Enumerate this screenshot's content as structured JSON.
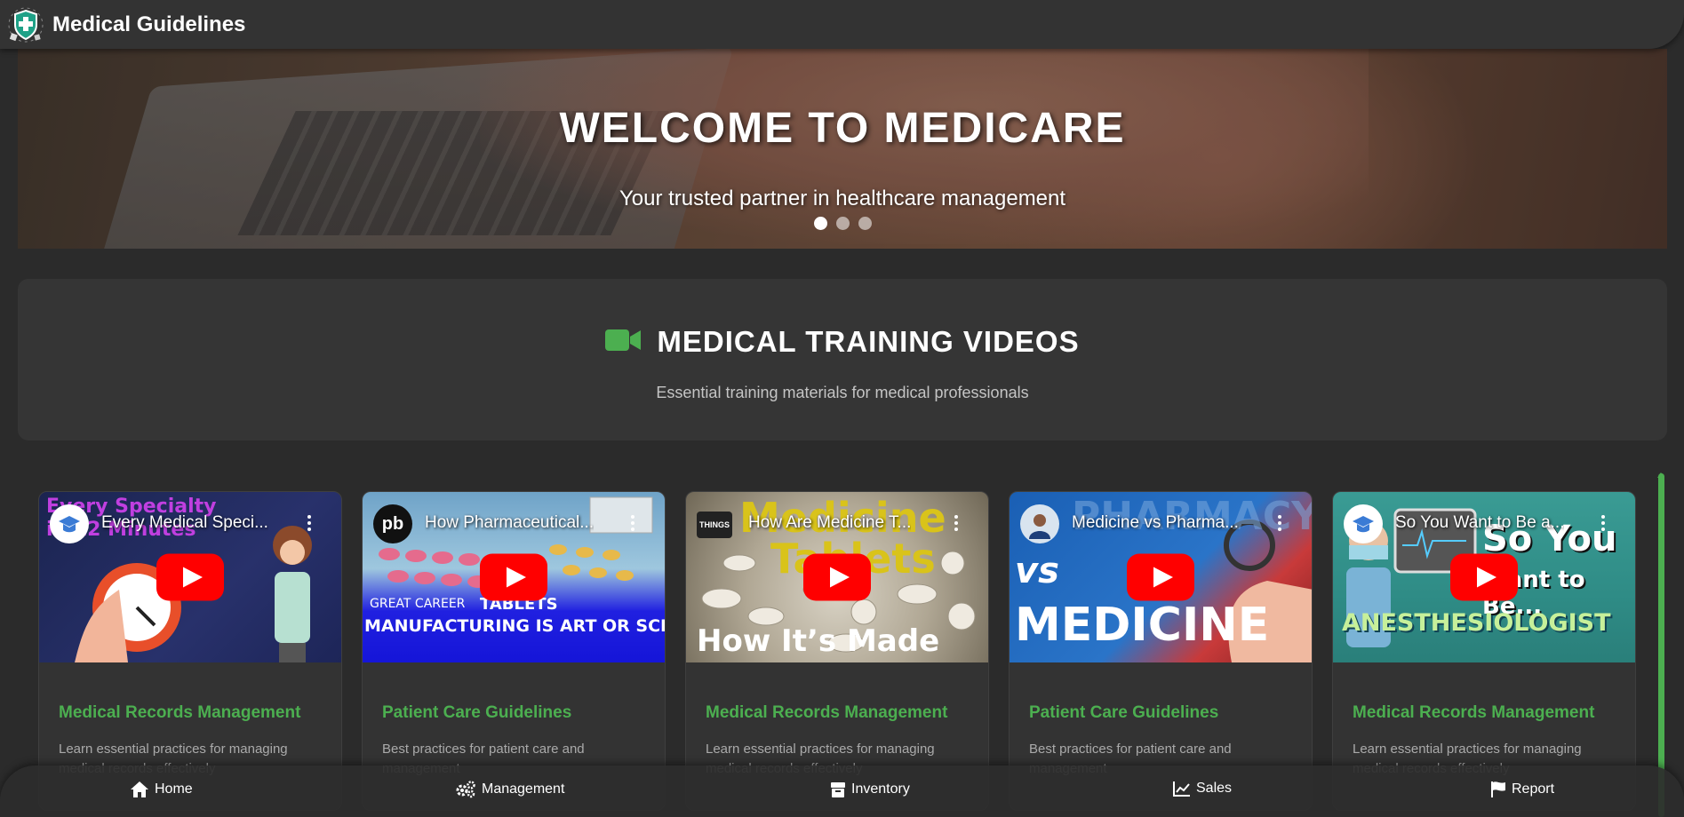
{
  "header": {
    "title": "Medical Guidelines",
    "logo_icon": "shield-cross-icon"
  },
  "hero": {
    "title": "WELCOME TO MEDICARE",
    "subtitle": "Your trusted partner in healthcare management",
    "slides": 3,
    "active_slide": 1
  },
  "section": {
    "icon": "video-camera-icon",
    "title": "MEDICAL TRAINING VIDEOS",
    "subtitle": "Essential training materials for medical professionals",
    "accent_color": "#4caf50"
  },
  "videos": [
    {
      "video_title": "Every Medical Speci...",
      "title": "Medical Records Management",
      "description": "Learn essential practices for managing medical records effectively",
      "overlay_lines": [
        "Every Specialty",
        "in 12 Minutes"
      ]
    },
    {
      "video_title": "How Pharmaceutical...",
      "title": "Patient Care Guidelines",
      "description": "Best practices for patient care and management",
      "overlay_lines": [
        "GREAT CAREER",
        "TABLETS",
        "MANUFACTURING IS ART OR SCIENCE?"
      ]
    },
    {
      "video_title": "How Are Medicine T...",
      "title": "Medical Records Management",
      "description": "Learn essential practices for managing medical records effectively",
      "overlay_lines": [
        "Medicine",
        "Tablets",
        "How It’s Made"
      ]
    },
    {
      "video_title": "Medicine vs Pharma...",
      "title": "Patient Care Guidelines",
      "description": "Best practices for patient care and management",
      "overlay_lines": [
        "PHARMACY",
        "vs",
        "MEDICINE"
      ]
    },
    {
      "video_title": "So You Want to Be a...",
      "title": "Medical Records Management",
      "description": "Learn essential practices for managing medical records effectively",
      "overlay_lines": [
        "So You",
        "Want to Be...",
        "ANESTHESIOLOGIST"
      ]
    }
  ],
  "nav": [
    {
      "label": "Home",
      "icon": "home-icon"
    },
    {
      "label": "Management",
      "icon": "gears-icon"
    },
    {
      "label": "Inventory",
      "icon": "box-icon"
    },
    {
      "label": "Sales",
      "icon": "line-chart-icon"
    },
    {
      "label": "Report",
      "icon": "flag-icon"
    }
  ]
}
